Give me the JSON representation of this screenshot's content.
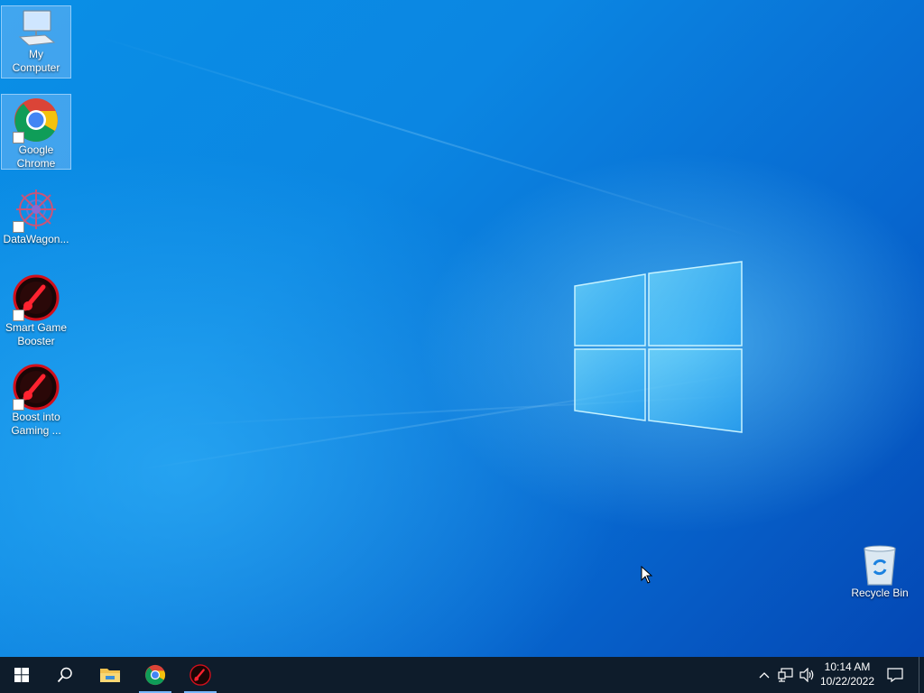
{
  "desktop": {
    "icons": [
      {
        "label": "My Computer",
        "icon": "computer-icon",
        "selected": true
      },
      {
        "label": "Google Chrome",
        "icon": "chrome-icon",
        "selected": true
      },
      {
        "label": "DataWagon...",
        "icon": "datawagon-icon",
        "selected": false
      },
      {
        "label": "Smart Game Booster",
        "icon": "game-booster-icon",
        "selected": false
      },
      {
        "label": "Boost into Gaming ...",
        "icon": "game-booster-icon",
        "selected": false
      }
    ],
    "recycle_bin": {
      "label": "Recycle Bin",
      "icon": "recycle-bin-icon"
    }
  },
  "taskbar": {
    "buttons": [
      {
        "name": "start-button",
        "icon": "windows-logo-icon"
      },
      {
        "name": "search-button",
        "icon": "search-icon"
      },
      {
        "name": "file-explorer-button",
        "icon": "folder-icon"
      },
      {
        "name": "chrome-taskbar-button",
        "icon": "chrome-icon"
      },
      {
        "name": "game-booster-taskbar-button",
        "icon": "game-booster-icon"
      }
    ],
    "tray": {
      "icons": [
        "chevron-up-icon",
        "network-icon",
        "volume-icon"
      ],
      "time": "10:14 AM",
      "date": "10/22/2022",
      "notification_icon": "notification-icon"
    }
  },
  "colors": {
    "taskbar": "#0e1c2b",
    "wallpaper_primary": "#0b86e2",
    "wallpaper_dark": "#0447b4",
    "selection": "#aad2ff"
  }
}
